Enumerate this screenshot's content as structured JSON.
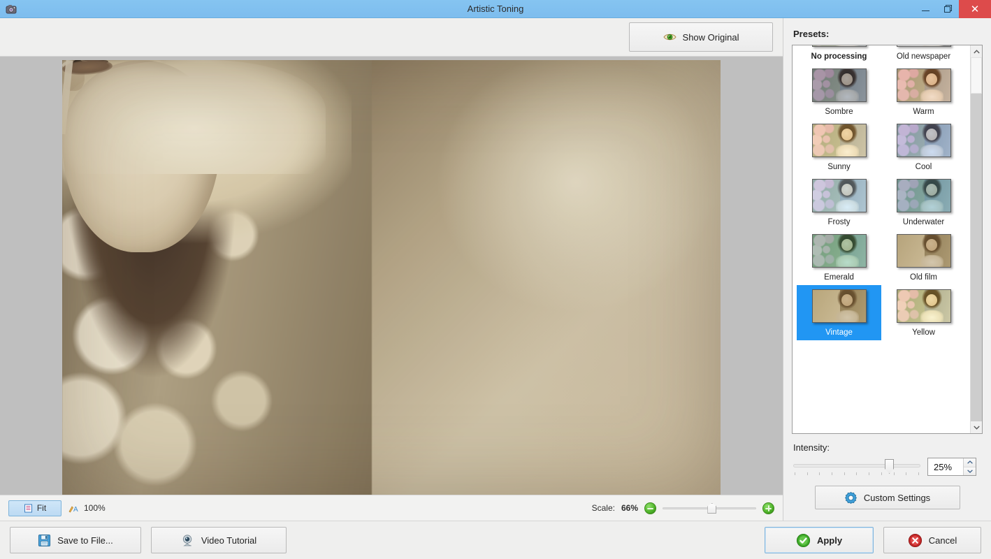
{
  "window": {
    "title": "Artistic Toning",
    "app_icon": "camera-icon",
    "minimize_label": "",
    "restore_label": "",
    "close_label": "✕"
  },
  "toolbar": {
    "show_original_label": "Show Original",
    "show_original_icon": "eye-icon"
  },
  "zoombar": {
    "fit_label": "Fit",
    "fit_icon": "fit-icon",
    "zoom_100_label": "100%",
    "zoom_100_icon": "actual-size-icon",
    "scale_label": "Scale:",
    "scale_value": "66%",
    "zoom_out_icon": "zoom-out-icon",
    "zoom_in_icon": "zoom-in-icon",
    "slider_position_percent": 48
  },
  "bottombar": {
    "save_label": "Save to File...",
    "save_icon": "floppy-disk-icon",
    "tutorial_label": "Video Tutorial",
    "tutorial_icon": "webcam-icon",
    "apply_label": "Apply",
    "apply_icon": "green-check-icon",
    "cancel_label": "Cancel",
    "cancel_icon": "red-x-icon"
  },
  "presets": {
    "label": "Presets:",
    "selected": "Vintage",
    "default": "No processing",
    "scroll_up_icon": "chevron-up-icon",
    "scroll_down_icon": "chevron-down-icon",
    "items": [
      {
        "name": "No processing",
        "tone": "t-noproc"
      },
      {
        "name": "Old newspaper",
        "tone": "t-oldnews"
      },
      {
        "name": "Sombre",
        "tone": "t-sombre"
      },
      {
        "name": "Warm",
        "tone": "t-warm"
      },
      {
        "name": "Sunny",
        "tone": "t-sunny"
      },
      {
        "name": "Cool",
        "tone": "t-cool"
      },
      {
        "name": "Frosty",
        "tone": "t-frosty"
      },
      {
        "name": "Underwater",
        "tone": "t-underwater"
      },
      {
        "name": "Emerald",
        "tone": "t-emerald"
      },
      {
        "name": "Old film",
        "tone": "t-oldfilm"
      },
      {
        "name": "Vintage",
        "tone": "t-vintage"
      },
      {
        "name": "Yellow",
        "tone": "t-yellow"
      }
    ]
  },
  "intensity": {
    "label": "Intensity:",
    "value": "25%",
    "slider_position_percent": 72,
    "spin_up_icon": "spinner-up-icon",
    "spin_down_icon": "spinner-down-icon",
    "custom_settings_label": "Custom Settings",
    "custom_settings_icon": "gear-icon"
  },
  "colors": {
    "titlebar": "#7ec1f0",
    "close_button": "#dd4b4b",
    "selection": "#2196f3",
    "accent_green": "#4fb32a",
    "canvas_bg": "#bfbfbf"
  },
  "canvas": {
    "image_description": "Sepia toned portrait of a woman beside white flowers"
  }
}
